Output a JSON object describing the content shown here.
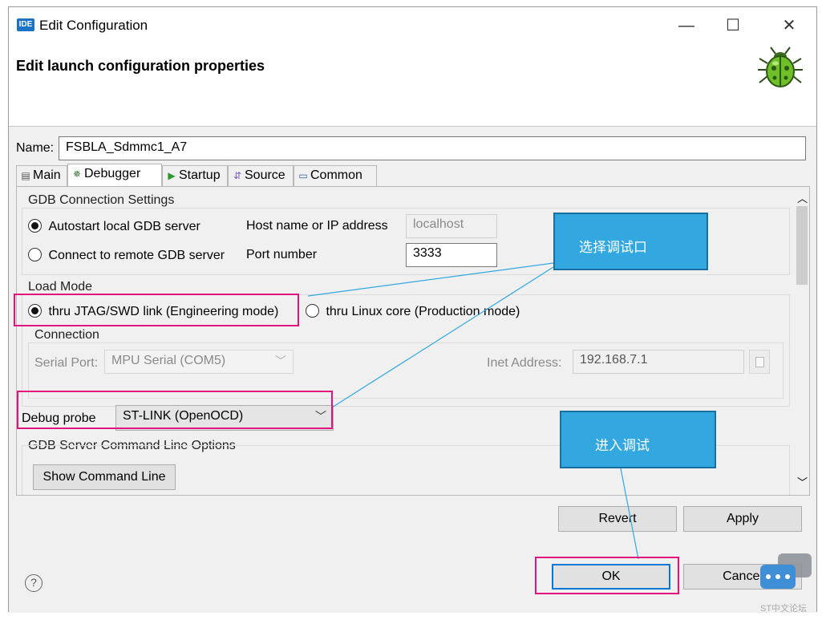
{
  "window": {
    "app_badge": "IDE",
    "title": "Edit Configuration",
    "header_title": "Edit launch configuration properties",
    "controls": {
      "minimize": "—",
      "maximize": "☐",
      "close": "✕"
    }
  },
  "name": {
    "label": "Name:",
    "value": "FSBLA_Sdmmc1_A7"
  },
  "tabs": [
    {
      "label": "Main",
      "icon": "document-icon",
      "active": false
    },
    {
      "label": "Debugger",
      "icon": "debugger-icon",
      "active": true
    },
    {
      "label": "Startup",
      "icon": "play-icon",
      "active": false
    },
    {
      "label": "Source",
      "icon": "source-icon",
      "active": false
    },
    {
      "label": "Common",
      "icon": "common-icon",
      "active": false
    }
  ],
  "gdb_connection": {
    "title": "GDB Connection Settings",
    "autostart_label": "Autostart local GDB server",
    "autostart_selected": true,
    "remote_label": "Connect to remote GDB server",
    "host_label": "Host name or IP address",
    "host_value": "localhost",
    "port_label": "Port number",
    "port_value": "3333"
  },
  "load_mode": {
    "title": "Load Mode",
    "jtag_label": "thru JTAG/SWD link (Engineering mode)",
    "jtag_selected": true,
    "linux_label": "thru Linux core (Production mode)"
  },
  "connection": {
    "title": "Connection",
    "serial_label": "Serial Port:",
    "serial_value": "MPU Serial (COM5)",
    "inet_label": "Inet Address:",
    "inet_value": "192.168.7.1"
  },
  "debug_probe": {
    "label": "Debug probe",
    "value": "ST-LINK (OpenOCD)"
  },
  "gdb_server_options": {
    "title": "GDB Server Command Line Options",
    "button": "Show Command Line"
  },
  "buttons": {
    "revert": "Revert",
    "apply": "Apply",
    "ok": "OK",
    "cancel": "Cancel"
  },
  "help_icon": "?",
  "annotations": {
    "callout_debug_port": "选择调试口",
    "callout_enter_debug": "进入调试"
  },
  "watermark": "ST中文论坛",
  "colors": {
    "callout": "#33a8e0",
    "highlight": "#e2137e",
    "focus": "#0078d7"
  }
}
